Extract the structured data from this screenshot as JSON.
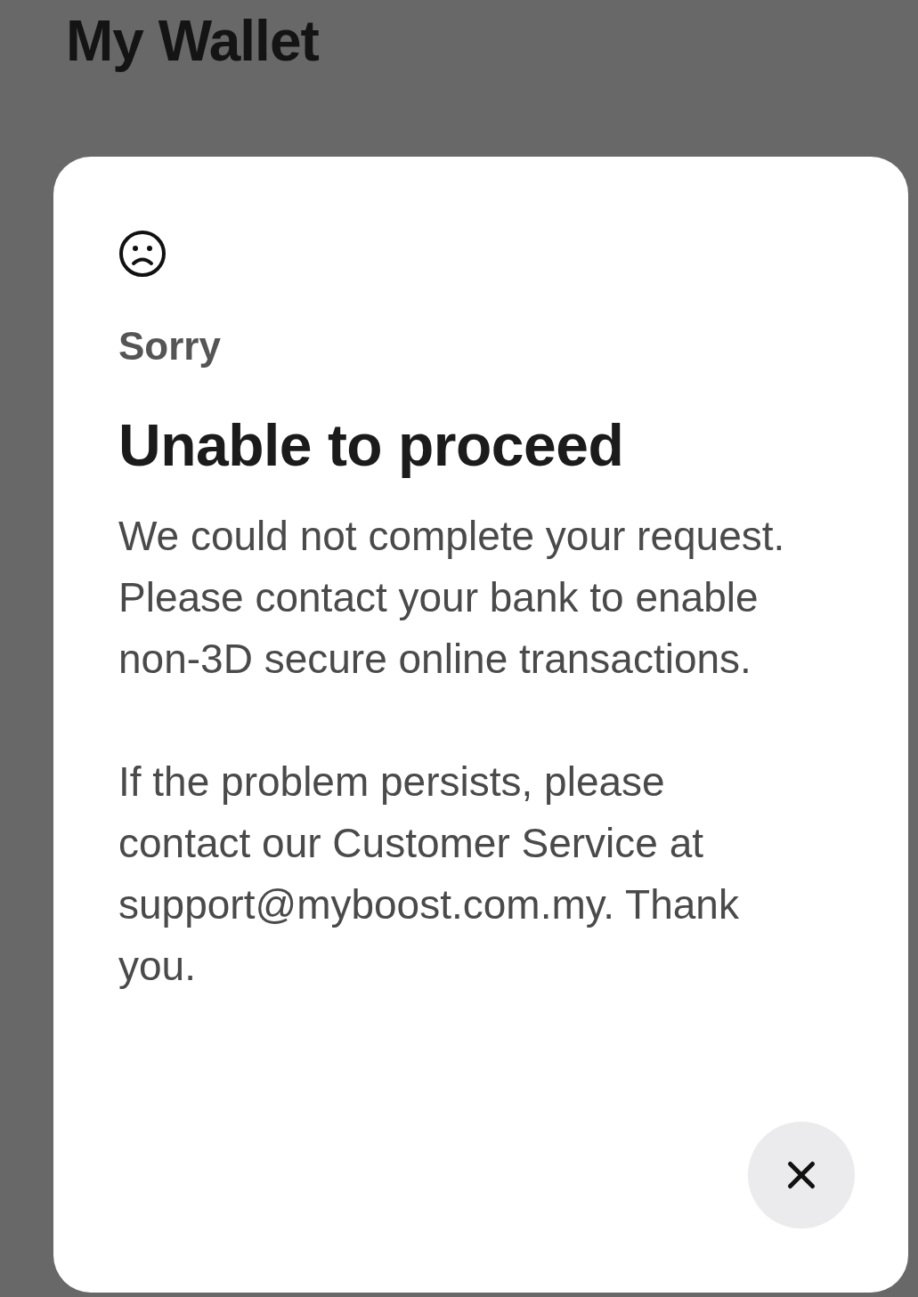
{
  "page": {
    "title": "My Wallet"
  },
  "dialog": {
    "eyebrow": "Sorry",
    "title": "Unable to proceed",
    "paragraphs": [
      "We could not complete your request. Please contact your bank to enable non-3D secure online transactions.",
      "If the problem persists, please contact our Customer Service at support@myboost.com.my. Thank you."
    ]
  }
}
